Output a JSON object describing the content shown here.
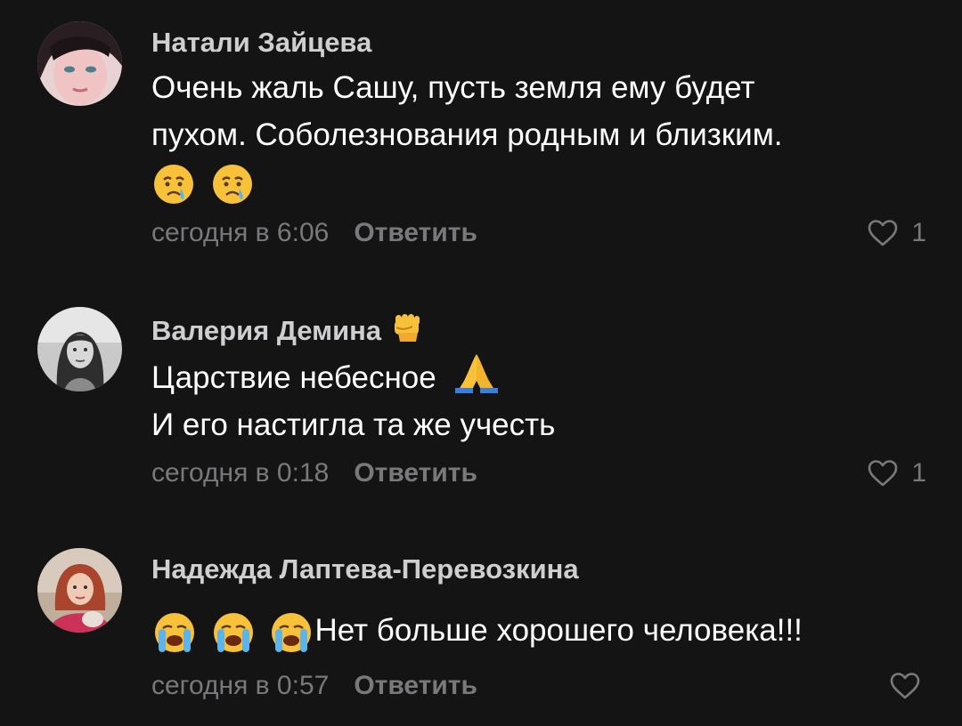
{
  "comments": [
    {
      "author": "Натали Зайцева",
      "text_lines": [
        "Очень жаль Сашу, пусть земля ему будет",
        "пухом. Соболезнования родным и близким."
      ],
      "emojis_line": [
        "crying-face-icon",
        "crying-face-icon"
      ],
      "time": "сегодня в 6:06",
      "reply_label": "Ответить",
      "likes": "1"
    },
    {
      "author": "Валерия Демина",
      "author_emoji": "raised-fist-icon",
      "text_line_1": "Царствие небесное",
      "text_line_1_emoji": "folded-hands-icon",
      "text_line_2": "И его настигла та же учесть",
      "time": "сегодня в 0:18",
      "reply_label": "Ответить",
      "likes": "1"
    },
    {
      "author": "Надежда Лаптева-Перевозкина",
      "leading_emojis": [
        "loudly-crying-face-icon",
        "loudly-crying-face-icon",
        "loudly-crying-face-icon"
      ],
      "text": "Нет больше хорошего человека!!!",
      "time": "сегодня в 0:57",
      "reply_label": "Ответить",
      "likes": ""
    }
  ],
  "colors": {
    "background": "#141414",
    "author": "#cfcfd1",
    "text": "#ffffff",
    "meta": "#79797c"
  }
}
